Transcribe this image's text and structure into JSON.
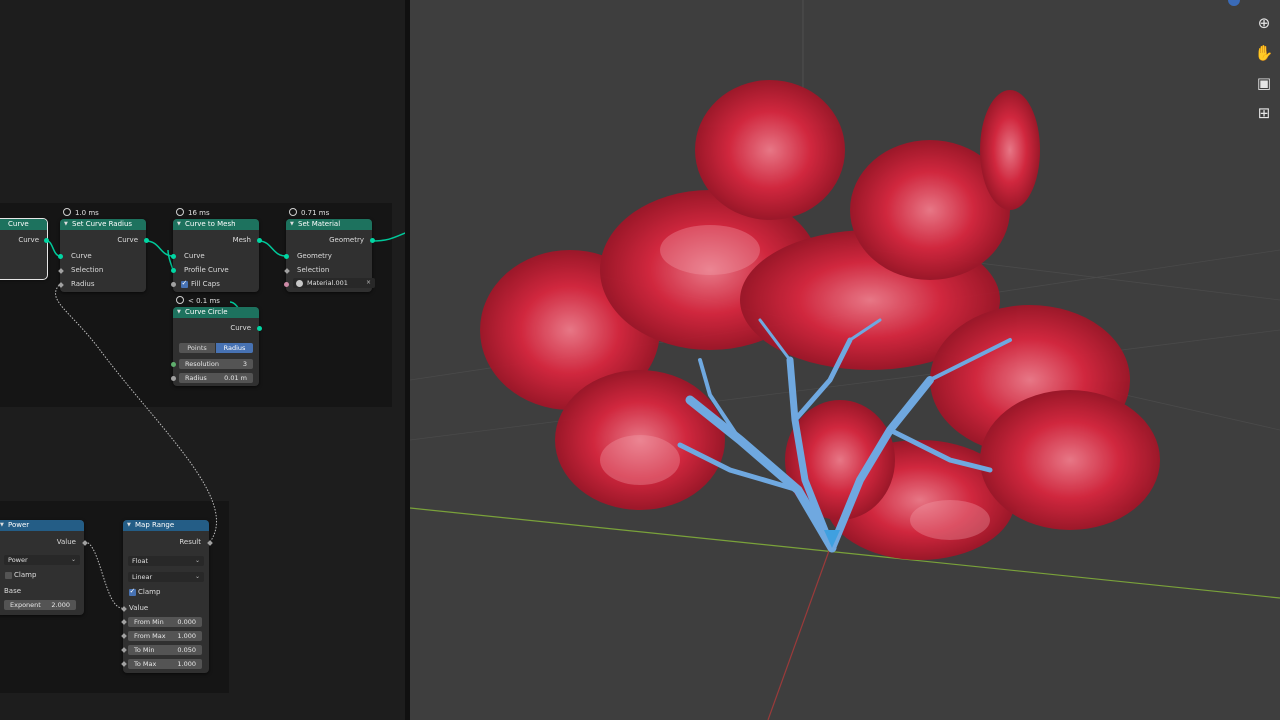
{
  "nodes": {
    "curve_partial": {
      "title": "Curve",
      "output": "Curve"
    },
    "set_curve_radius": {
      "timing": "1.0 ms",
      "title": "Set Curve Radius",
      "output": "Curve",
      "inputs": [
        "Curve",
        "Selection",
        "Radius"
      ]
    },
    "curve_to_mesh": {
      "timing": "16 ms",
      "title": "Curve to Mesh",
      "output": "Mesh",
      "inputs": [
        "Curve",
        "Profile Curve"
      ],
      "fill_caps": "Fill Caps"
    },
    "set_material": {
      "timing": "0.71 ms",
      "title": "Set Material",
      "output": "Geometry",
      "inputs": [
        "Geometry",
        "Selection"
      ],
      "material": "Material.001",
      "clear": "×"
    },
    "curve_circle": {
      "timing": "< 0.1 ms",
      "title": "Curve Circle",
      "output": "Curve",
      "modes": [
        "Points",
        "Radius"
      ],
      "active_mode": "Radius",
      "resolution_label": "Resolution",
      "resolution": "3",
      "radius_label": "Radius",
      "radius": "0.01 m"
    },
    "power": {
      "title": "Power",
      "output": "Value",
      "operation": "Power",
      "clamp": "Clamp",
      "base_label": "Base",
      "exponent_label": "Exponent",
      "exponent": "2.000"
    },
    "map_range": {
      "title": "Map Range",
      "output": "Result",
      "data_type": "Float",
      "interpolation": "Linear",
      "clamp": "Clamp",
      "value_label": "Value",
      "fields": [
        {
          "label": "From Min",
          "value": "0.000"
        },
        {
          "label": "From Max",
          "value": "1.000"
        },
        {
          "label": "To Min",
          "value": "0.050"
        },
        {
          "label": "To Max",
          "value": "1.000"
        }
      ]
    }
  },
  "viewport": {
    "tools": [
      {
        "name": "zoom-icon",
        "glyph": "⊕"
      },
      {
        "name": "hand-pan-icon",
        "glyph": "✋"
      },
      {
        "name": "camera-icon",
        "glyph": "▣"
      },
      {
        "name": "grid-perspective-icon",
        "glyph": "⊞"
      }
    ],
    "colors": {
      "background": "#3e3e3e",
      "foliage": "#d8263e",
      "branches": "#6fa8e0",
      "x_axis": "#9a3a3a",
      "y_axis": "#7aa23a"
    }
  }
}
